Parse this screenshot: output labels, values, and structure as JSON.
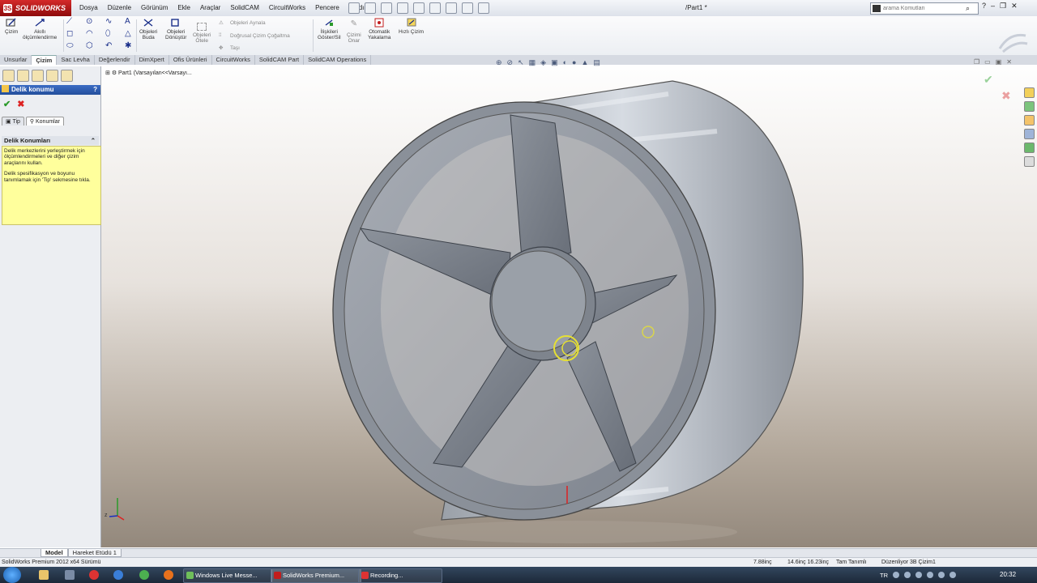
{
  "app": {
    "logo": "SOLIDWORKS",
    "document_title": "/Part1 *"
  },
  "menu": [
    "Dosya",
    "Düzenle",
    "Görünüm",
    "Ekle",
    "Araçlar",
    "SolidCAM",
    "CircuitWorks",
    "Pencere",
    "Yardım"
  ],
  "search": {
    "placeholder": "arama Komutları"
  },
  "commands": {
    "cizim": "Çizim",
    "akilli": [
      "Akıllı",
      "ölçümlendirme"
    ],
    "budala": [
      "Objeleri",
      "Buda"
    ],
    "donustur": [
      "Objeleri",
      "Dönüştür"
    ],
    "otele": [
      "Objeleri",
      "Ötele"
    ],
    "aynala": "Objeleri Aynala",
    "cogalt": "Doğrusal Çizim Çoğaltma",
    "tasi": "Taşı",
    "iliskiler": [
      "İlişkileri",
      "Göster/Sil"
    ],
    "onar": [
      "Çizimi",
      "Onar"
    ],
    "yakalama": [
      "Otomatik",
      "Yakalama"
    ],
    "hizli": "Hızlı Çizim"
  },
  "tabs": [
    "Unsurlar",
    "Çizim",
    "Sac Levha",
    "Değerlendir",
    "DimXpert",
    "Ofis Ürünleri",
    "CircuitWorks",
    "SolidCAM Part",
    "SolidCAM Operations"
  ],
  "active_tab": "Çizim",
  "property_manager": {
    "title": "Delik konumu",
    "subtabs": [
      "Tip",
      "Konumlar"
    ],
    "group_title": "Delik Konumları",
    "hint_1": "Delik merkezlerini yerleştirmek için ölçümlendirmeleri ve diğer çizim araçlarını kullan.",
    "hint_2": "Delik spesifikasyon ve boyunu tanımlamak için 'Tip' sekmesine tıkla."
  },
  "tree": {
    "root": "Part1  (Varsayılan<<Varsayı..."
  },
  "bottom_tabs": [
    "Model",
    "Hareket Etüdü 1"
  ],
  "status": {
    "left": "SolidWorks Premium 2012 x64 Sürümü",
    "v1": "7.88inç",
    "v2": "14.6inç 16.23inç",
    "v3": "Tam Tanımlı",
    "v4": "Düzenliyor 3B Çizim1"
  },
  "taskbar": {
    "tasks": [
      "Windows Live Messe...",
      "SolidWorks Premium...",
      "Recording..."
    ],
    "lang": "TR",
    "clock": "20:32"
  },
  "colors": {
    "accent": "#2a5bb0",
    "hint_bg": "#ffff9c",
    "logo_red": "#c21d1d"
  }
}
